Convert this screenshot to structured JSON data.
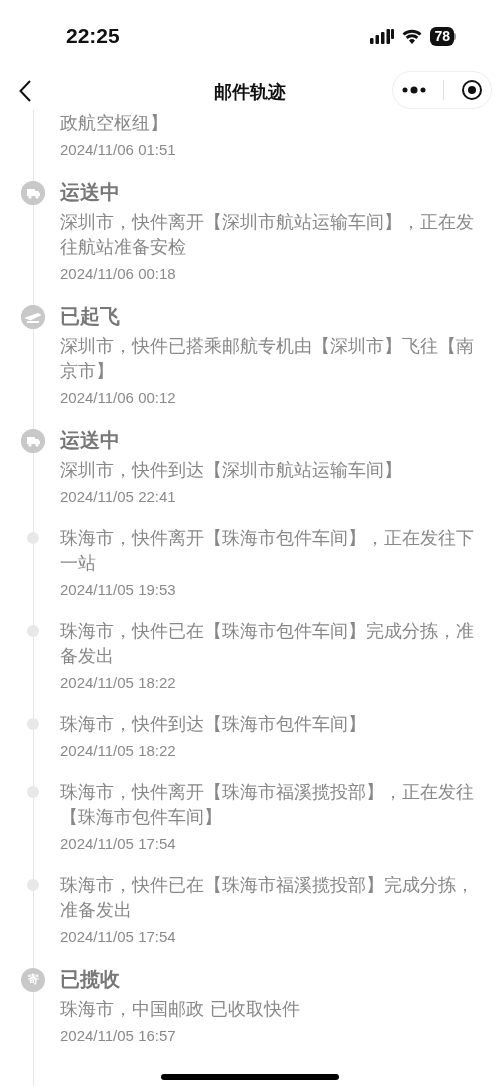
{
  "status_bar": {
    "time": "22:25",
    "battery": "78"
  },
  "nav": {
    "title": "邮件轨迹"
  },
  "events": [
    {
      "kind": "cut",
      "description": "政航空枢纽】",
      "time": "2024/11/06 01:51"
    },
    {
      "kind": "truck",
      "title": "运送中",
      "description": "深圳市，快件离开【深圳市航站运输车间】，正在发往航站准备安检",
      "time": "2024/11/06 00:18"
    },
    {
      "kind": "plane",
      "title": "已起飞",
      "description": "深圳市，快件已搭乘邮航专机由【深圳市】飞往【南京市】",
      "time": "2024/11/06 00:12"
    },
    {
      "kind": "truck",
      "title": "运送中",
      "description": "深圳市，快件到达【深圳市航站运输车间】",
      "time": "2024/11/05 22:41"
    },
    {
      "kind": "dot",
      "description": "珠海市，快件离开【珠海市包件车间】，正在发往下一站",
      "time": "2024/11/05 19:53"
    },
    {
      "kind": "dot",
      "description": "珠海市，快件已在【珠海市包件车间】完成分拣，准备发出",
      "time": "2024/11/05 18:22"
    },
    {
      "kind": "dot",
      "description": "珠海市，快件到达【珠海市包件车间】",
      "time": "2024/11/05 18:22"
    },
    {
      "kind": "dot",
      "description": "珠海市，快件离开【珠海市福溪揽投部】，正在发往【珠海市包件车间】",
      "time": "2024/11/05 17:54"
    },
    {
      "kind": "dot",
      "description": "珠海市，快件已在【珠海市福溪揽投部】完成分拣，准备发出",
      "time": "2024/11/05 17:54"
    },
    {
      "kind": "collect",
      "icon_text": "寄",
      "title": "已揽收",
      "description": "珠海市，中国邮政 已收取快件",
      "time": "2024/11/05 16:57"
    }
  ]
}
